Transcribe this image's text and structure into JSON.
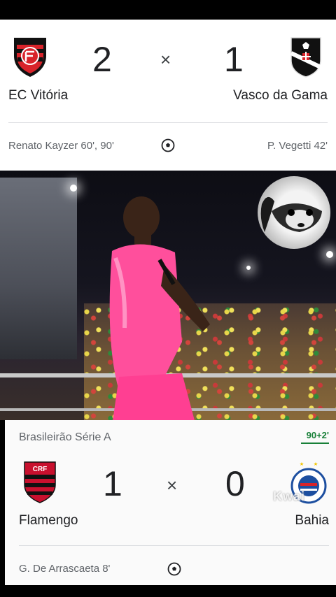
{
  "match1": {
    "home_team": "EC Vitória",
    "away_team": "Vasco da Gama",
    "home_score": "2",
    "away_score": "1",
    "separator": "×",
    "home_scorers": "Renato Kayzer 60', 90'",
    "away_scorers": "P. Vegetti 42'",
    "home_logo_icon": "vitoria-crest-icon",
    "away_logo_icon": "vasco-crest-icon"
  },
  "match2": {
    "league": "Brasileirão Série A",
    "live_time": "90+2'",
    "home_team": "Flamengo",
    "away_team": "Bahia",
    "home_score": "1",
    "away_score": "0",
    "separator": "×",
    "home_scorers": "G. De Arrascaeta 8'",
    "home_logo_icon": "flamengo-crest-icon",
    "away_logo_icon": "bahia-crest-icon"
  },
  "overlay": {
    "watermark": "Kwai"
  },
  "colors": {
    "card_bg": "#ffffff",
    "text": "#202124",
    "muted": "#5f6368",
    "live": "#188038",
    "singer_pink": "#ff4f9c"
  }
}
